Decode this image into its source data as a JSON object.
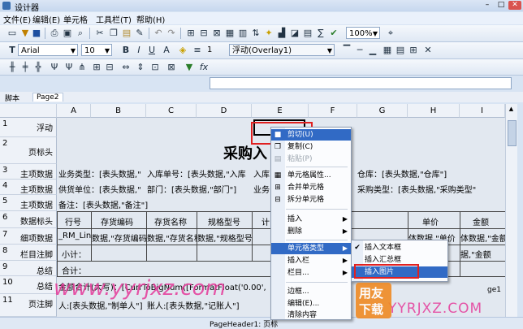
{
  "window": {
    "title": "设计器"
  },
  "menubar": [
    "文件(E)",
    "编辑(E)",
    "单元格",
    "工具栏(T)",
    "帮助(H)"
  ],
  "toolbar2": {
    "font": "Arial",
    "size": "10",
    "overlay": "浮动(Overlay1)",
    "zoom": "100%",
    "line_width": "1"
  },
  "tabs": [
    "脚本",
    "Page2"
  ],
  "columns": [
    "A",
    "B",
    "C",
    "D",
    "E",
    "F",
    "G",
    "H",
    "I"
  ],
  "rows": [
    {
      "n": "1",
      "label": "浮动"
    },
    {
      "n": "2",
      "label": "页标头"
    },
    {
      "n": "3",
      "label": "主项数据"
    },
    {
      "n": "4",
      "label": "主项数据"
    },
    {
      "n": "5",
      "label": "主项数据"
    },
    {
      "n": "6",
      "label": "数据标头"
    },
    {
      "n": "7",
      "label": "细项数据"
    },
    {
      "n": "8",
      "label": "栏目注脚"
    },
    {
      "n": "9",
      "label": "总结"
    },
    {
      "n": "10",
      "label": "总结"
    },
    {
      "n": "11",
      "label": "页注脚"
    }
  ],
  "cells": {
    "title": "采购入",
    "r3a": "业务类型：[表头数据,\"",
    "r3c": "入库单号：[表头数据,\"入库",
    "r3e": "入库",
    "r3g": "仓库：[表头数据,\"仓库\"]",
    "r4a": "供货单位：[表头数据,\"",
    "r4c": "部门：[表头数据,\"部门\"]",
    "r4e": "业务",
    "r4g": "采购类型：[表头数据,\"采购类型\"",
    "r5a": "备注：[表头数据,\"备注\"]",
    "h_row": "行号",
    "h_code": "存货编码",
    "h_name": "存货名称",
    "h_spec": "规格型号",
    "h_unit": "计",
    "h_price": "单价",
    "h_amount": "金额",
    "r7a": "_RM_Line",
    "r7b": "数据,\"存货编码",
    "r7c": "数据,\"存货名称",
    "r7d": "数据,\"规格型号",
    "r7g": "体数据,\"单价",
    "r7h": "体数据,\"金额",
    "r8a": "小计：",
    "r8h": "据,\"金额",
    "r9a": "合计：",
    "r10a": "金额合计(大写)：[CurrToBigNum([FormatFloat('0.00',",
    "r11a": "人:[表头数据,\"制单人\"]",
    "r11c": "账人:[表头数据,\"记账人\"]"
  },
  "context_menu": [
    {
      "label": "剪切(U)",
      "icon": "cut-icon",
      "state": "selected"
    },
    {
      "label": "复制(C)",
      "icon": "copy-icon",
      "state": "normal"
    },
    {
      "label": "粘贴(P)",
      "icon": "paste-icon",
      "state": "disabled"
    },
    {
      "label": "单元格属性...",
      "icon": "cell-properties-icon",
      "state": "normal"
    },
    {
      "label": "合并单元格",
      "icon": "merge-cells-icon",
      "state": "normal"
    },
    {
      "label": "拆分单元格",
      "icon": "split-cells-icon",
      "state": "normal"
    },
    {
      "label": "插入",
      "icon": "",
      "state": "submenu"
    },
    {
      "label": "删除",
      "icon": "",
      "state": "submenu"
    },
    {
      "label": "单元格类型",
      "icon": "",
      "state": "active-submenu"
    },
    {
      "label": "插入栏",
      "icon": "",
      "state": "submenu"
    },
    {
      "label": "栏目...",
      "icon": "",
      "state": "submenu"
    },
    {
      "label": "边框...",
      "icon": "",
      "state": "normal"
    },
    {
      "label": "编辑(E)...",
      "icon": "",
      "state": "normal"
    },
    {
      "label": "清除内容",
      "icon": "",
      "state": "normal"
    }
  ],
  "submenu": [
    {
      "label": "插入文本框",
      "checked": true,
      "state": "normal"
    },
    {
      "label": "插入汇总框",
      "checked": false,
      "state": "normal"
    },
    {
      "label": "插入图片",
      "checked": false,
      "state": "selected"
    }
  ],
  "status": {
    "left": "PageHeader1: 页标",
    "right": "ge1"
  },
  "watermark": {
    "site": "www.yyrjxz.com",
    "brand": "YYRJXZ.COM",
    "logo1": "用友",
    "logo2": "下载"
  },
  "colors": {
    "accent": "#316ac5",
    "red": "#e02020"
  }
}
